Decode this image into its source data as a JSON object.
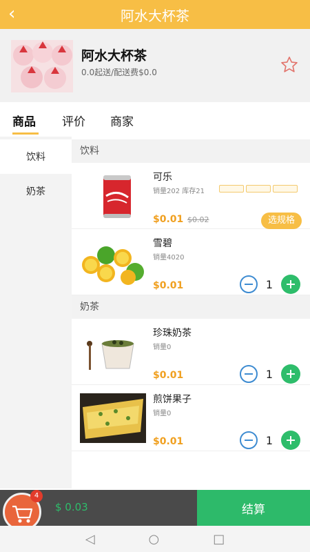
{
  "header": {
    "back_icon": "chevron-left-icon",
    "title": "阿水大杯茶"
  },
  "shop": {
    "name": "阿水大杯茶",
    "fee_text": "0.0起送/配送费$0.0",
    "logo_icon": "strawberry-cupcake-image",
    "favorite_icon": "star-outline-icon"
  },
  "tabs": [
    {
      "label": "商品"
    },
    {
      "label": "评价"
    },
    {
      "label": "商家"
    }
  ],
  "categories": [
    {
      "label": "饮料"
    },
    {
      "label": "奶茶"
    }
  ],
  "sections": [
    {
      "title": "饮料",
      "items": [
        {
          "name": "可乐",
          "sales": "销量202 库存21",
          "price": "$0.01",
          "old_price": "$0.02",
          "action": "选规格",
          "image": "cola-can-image"
        },
        {
          "name": "雪碧",
          "sales": "销量4020",
          "price": "$0.01",
          "qty": "1",
          "image": "limes-image"
        }
      ]
    },
    {
      "title": "奶茶",
      "items": [
        {
          "name": "珍珠奶茶",
          "sales": "销量0",
          "price": "$0.01",
          "qty": "1",
          "image": "bubble-tea-image"
        },
        {
          "name": "煎饼果子",
          "sales": "销量0",
          "price": "$0.01",
          "qty": "1",
          "image": "jianbing-image"
        }
      ]
    }
  ],
  "cart": {
    "badge": "4",
    "total": "$ 0.03",
    "checkout_label": "结算",
    "cart_icon": "shopping-cart-icon"
  },
  "nav": {
    "back": "◁",
    "home": "○",
    "recents": "□"
  },
  "colors": {
    "accent": "#f7be45",
    "green": "#2ebd6b",
    "blue": "#3d8bd1",
    "price": "#f0a020"
  }
}
